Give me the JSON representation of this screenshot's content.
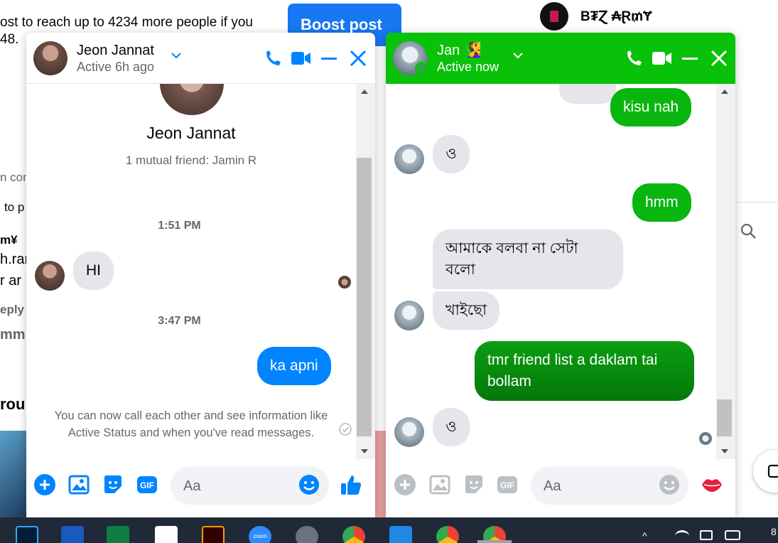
{
  "background": {
    "boost_text_line1": "ost to reach up to 4234 more people if you",
    "boost_text_line2": "48.",
    "boost_button": "Boost post",
    "fragments": [
      "n con",
      "to p",
      "m¥",
      "h.ran",
      "r ar",
      "eply",
      "mm",
      "rou"
    ],
    "page_name": "B₮Ɀ ₳Ɽ₥Ɏ"
  },
  "chat1": {
    "name": "Jeon Jannat",
    "status": "Active 6h ago",
    "profile_name": "Jeon Jannat",
    "mutual": "1 mutual friend: Jamin R",
    "stamp1": "1:51 PM",
    "msg_in_1": "HI",
    "stamp2": "3:47 PM",
    "msg_out_1": "ka apni",
    "notice": "You can now call each other and see information like Active Status and when you've read messages.",
    "input_placeholder": "Aa",
    "accent": "#0084ff"
  },
  "chat2": {
    "name": "Jan 🧏‍♀️",
    "status": "Active now",
    "msg_out_1": "kisu nah",
    "msg_in_1": "ও",
    "msg_out_2": "hmm",
    "msg_in_2": "আমাকে বলবা না সেটা বলো",
    "msg_in_3": "খাইছো",
    "msg_out_3": "tmr friend list a daklam tai bollam",
    "msg_in_4": "ও",
    "input_placeholder": "Aa",
    "accent": "#0ac10a"
  },
  "taskbar": {
    "apps": [
      "photoshop-icon",
      "word-icon",
      "excel-icon",
      "acrobat-icon",
      "illustrator-icon",
      "zoom-icon",
      "whatsapp-icon",
      "chrome-icon",
      "vscode-icon",
      "chrome-profile-icon",
      "chrome-profile-icon"
    ],
    "zoom_label": "zoom",
    "clock_fragment": "8"
  }
}
